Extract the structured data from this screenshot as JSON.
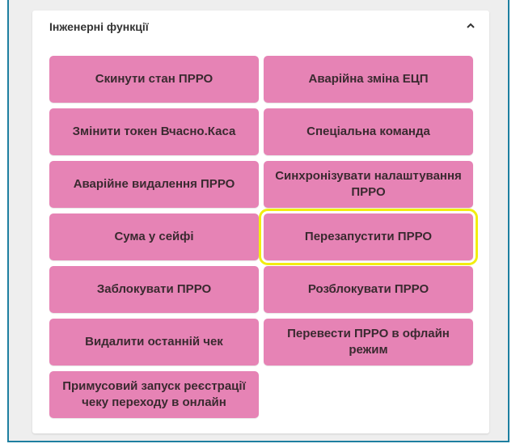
{
  "panel": {
    "title": "Інженерні функції",
    "collapse_icon": "chevron-up-icon"
  },
  "buttons": [
    {
      "label": "Скинути стан ПРРО"
    },
    {
      "label": "Аварійна зміна ЕЦП"
    },
    {
      "label": "Змінити токен Вчасно.Каса"
    },
    {
      "label": "Спеціальна команда"
    },
    {
      "label": "Аварійне видалення ПРРО"
    },
    {
      "label": "Синхронізувати налаштування ПРРО"
    },
    {
      "label": "Сума у сейфі"
    },
    {
      "label": "Перезапустити ПРРО"
    },
    {
      "label": "Заблокувати ПРРО"
    },
    {
      "label": "Розблокувати ПРРО"
    },
    {
      "label": "Видалити останній чек"
    },
    {
      "label": "Перевести ПРРО в офлайн режим"
    },
    {
      "label": "Примусовий запуск реєстрації чеку переходу в онлайн"
    }
  ],
  "colors": {
    "button_bg": "#e683b5",
    "highlight": "#f2ee10",
    "frame_border": "#1e7fa0"
  }
}
